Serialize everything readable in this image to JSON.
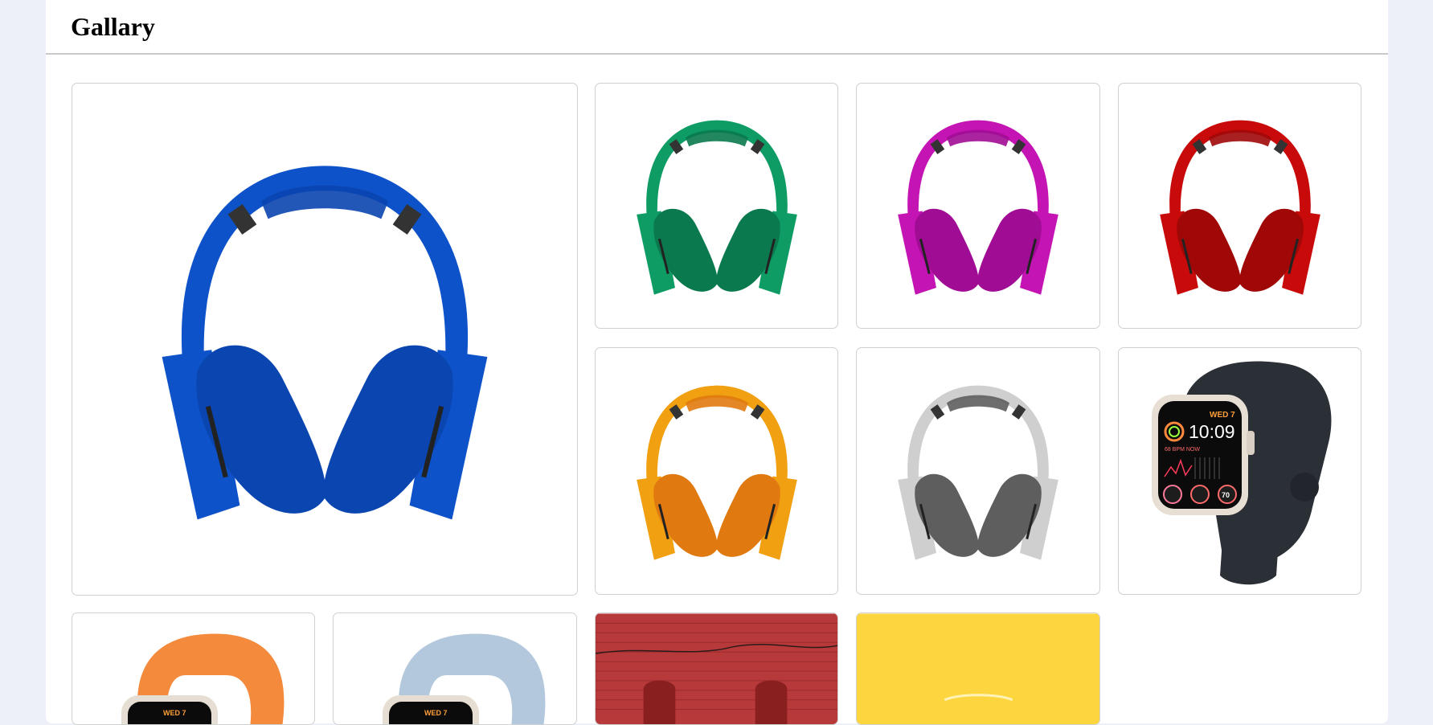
{
  "header": {
    "title": "Gallary"
  },
  "gallery": {
    "items": [
      {
        "icon": "headphones-blue-icon",
        "color": "#0d52c8",
        "cushion": "#0a45b0"
      },
      {
        "icon": "headphones-green-icon",
        "color": "#0f9c64",
        "cushion": "#0a7a4e"
      },
      {
        "icon": "headphones-magenta-icon",
        "color": "#c414b4",
        "cushion": "#a00c94"
      },
      {
        "icon": "headphones-red-icon",
        "color": "#c80a0a",
        "cushion": "#a00808"
      },
      {
        "icon": "headphones-orange-icon",
        "color": "#f0a010",
        "cushion": "#e07a10"
      },
      {
        "icon": "headphones-silver-icon",
        "color": "#cfcfcf",
        "cushion": "#5e5e5e"
      },
      {
        "icon": "smartwatch-midnight-icon",
        "band": "#2b2f36",
        "watch_day": "WED 7",
        "watch_time": "10:09",
        "watch_bpm": "68 BPM NOW",
        "watch_value": "70"
      },
      {
        "icon": "smartwatch-orange-icon",
        "band": "#f48a3c",
        "watch_day": "WED 7"
      },
      {
        "icon": "smartwatch-blue-icon",
        "band": "#b3c8dc",
        "watch_day": "WED 7"
      },
      {
        "icon": "brick-wall-photo-icon",
        "color": "#b8393a"
      },
      {
        "icon": "yellow-photo-icon",
        "color": "#fdd53e"
      }
    ]
  }
}
